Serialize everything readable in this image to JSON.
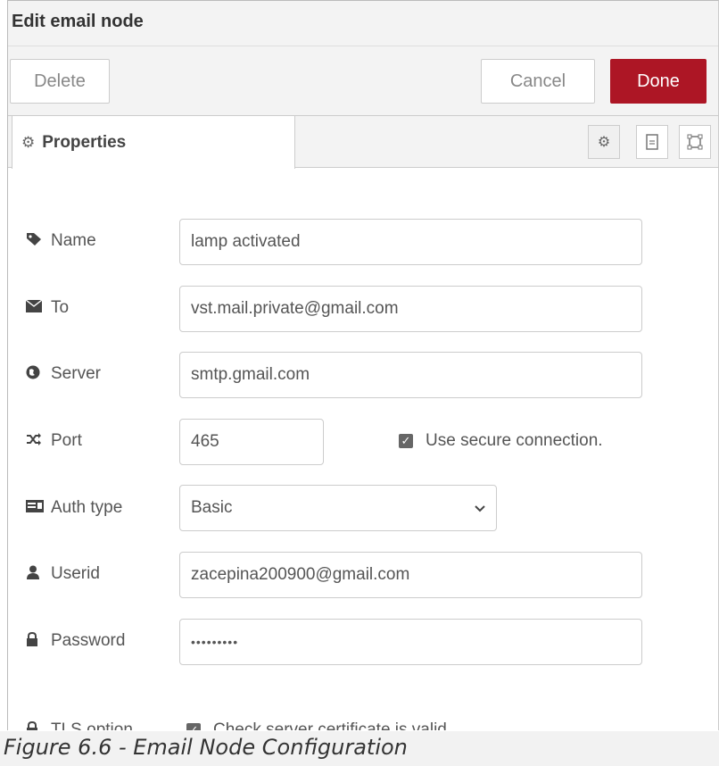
{
  "dialog": {
    "title": "Edit email node",
    "delete_label": "Delete",
    "cancel_label": "Cancel",
    "done_label": "Done",
    "done_color": "#ad1625"
  },
  "tabs": {
    "properties_label": "Properties"
  },
  "form": {
    "name": {
      "label": "Name",
      "value": "lamp activated"
    },
    "to": {
      "label": "To",
      "value": "vst.mail.private@gmail.com"
    },
    "server": {
      "label": "Server",
      "value": "smtp.gmail.com"
    },
    "port": {
      "label": "Port",
      "value": "465",
      "secure_label": "Use secure connection.",
      "secure_checked": true
    },
    "auth": {
      "label": "Auth type",
      "value": "Basic"
    },
    "userid": {
      "label": "Userid",
      "value": "zacepina200900@gmail.com"
    },
    "password": {
      "label": "Password",
      "value": "•••••••••"
    },
    "tls": {
      "label": "TLS option",
      "check_label": "Check server certificate is valid",
      "checked": true
    }
  },
  "caption": "Figure 6.6 - Email Node Configuration"
}
